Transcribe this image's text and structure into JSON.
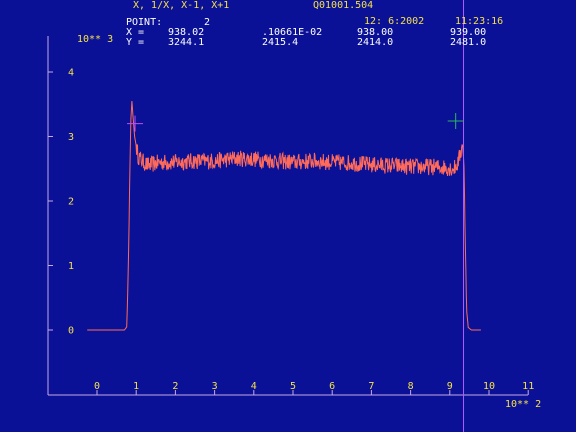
{
  "colors": {
    "background": "#0a1196",
    "header_text": "#f5e04a",
    "axis_text": "#f5e04a",
    "axis_line": "#c8a8e8",
    "trace": "#ff6a5a",
    "cursor_main": "#b05cff",
    "cursor_a": "#c04ef0",
    "cursor_b": "#2ab860"
  },
  "header": {
    "title": "X, 1/X, X-1, X+1",
    "file": "Q01001.504",
    "date": "12: 6:2002",
    "time": "11:23:16",
    "point_label": "POINT:",
    "point_value": "2",
    "x_label": "X =",
    "y_label": "Y =",
    "x_values": [
      "938.02",
      ".10661E-02",
      "938.00",
      "939.00"
    ],
    "y_values": [
      "3244.1",
      "2415.4",
      "2414.0",
      "2481.0"
    ]
  },
  "y_axis": {
    "multiplier": "10** 3",
    "ticks": [
      "0",
      "1",
      "2",
      "3",
      "4"
    ]
  },
  "x_axis": {
    "multiplier": "10** 2",
    "ticks": [
      "0",
      "1",
      "2",
      "3",
      "4",
      "5",
      "6",
      "7",
      "8",
      "9",
      "10",
      "11"
    ]
  },
  "chart_data": {
    "type": "line",
    "title": "Q01001.504",
    "xlabel": "10** 2",
    "ylabel": "10** 3",
    "xlim": [
      -1.3,
      11.8
    ],
    "ylim": [
      -0.5,
      4.5
    ],
    "series": [
      {
        "x": [
          -0.25,
          0.7,
          0.76,
          0.8,
          0.84,
          0.86,
          0.89,
          0.92,
          0.96,
          1.0,
          1.05,
          1.15,
          1.3,
          1.6,
          2.0,
          2.5,
          3.0,
          3.5,
          4.0,
          4.5,
          5.0,
          5.5,
          6.0,
          6.5,
          7.0,
          7.5,
          8.0,
          8.5,
          8.9,
          9.1,
          9.2,
          9.28,
          9.32,
          9.36,
          9.4,
          9.43,
          9.47,
          9.55,
          9.8
        ],
        "y": [
          0,
          0,
          0.05,
          1.0,
          2.5,
          3.2,
          3.55,
          3.3,
          3.0,
          2.85,
          2.7,
          2.62,
          2.55,
          2.6,
          2.6,
          2.62,
          2.62,
          2.66,
          2.65,
          2.63,
          2.6,
          2.62,
          2.6,
          2.59,
          2.56,
          2.55,
          2.53,
          2.53,
          2.52,
          2.5,
          2.58,
          2.75,
          2.9,
          2.6,
          1.2,
          0.3,
          0.04,
          0,
          0
        ]
      }
    ],
    "markers": [
      {
        "name": "cursor-a",
        "x": 0.97,
        "y": 3.2
      },
      {
        "name": "cursor-b",
        "x": 9.15,
        "y": 3.24
      }
    ],
    "vertical_cursor_x": 9.35
  }
}
